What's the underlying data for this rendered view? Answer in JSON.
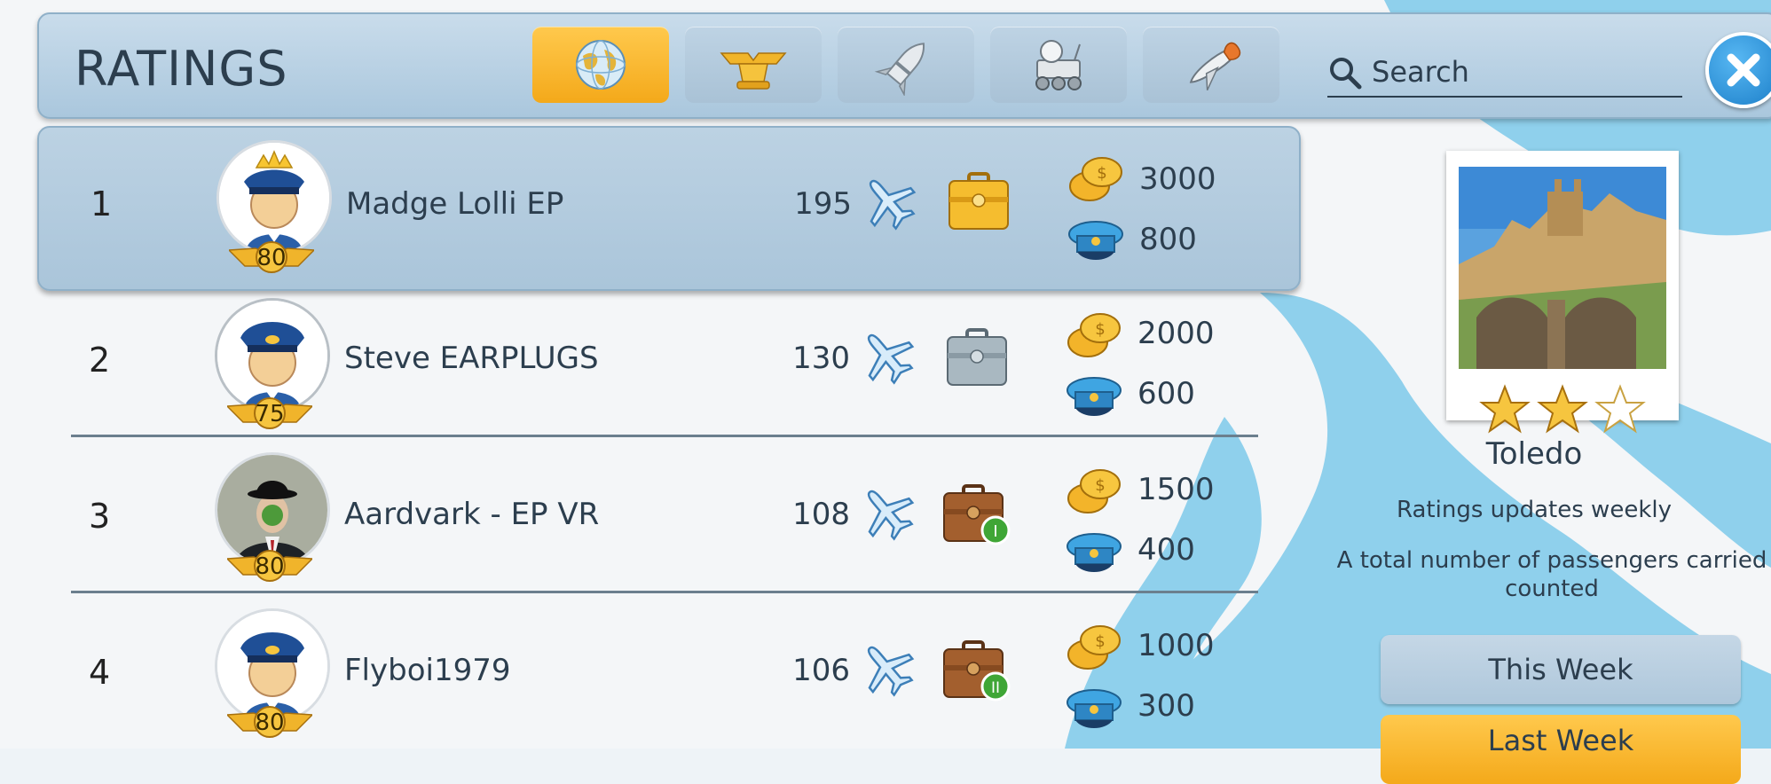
{
  "header": {
    "title": "RATINGS",
    "tabs": [
      {
        "icon": "globe-icon",
        "active": true
      },
      {
        "icon": "pilot-cap-wings-icon",
        "active": false
      },
      {
        "icon": "rocket-icon",
        "active": false
      },
      {
        "icon": "lunar-rover-icon",
        "active": false
      },
      {
        "icon": "space-shuttle-icon",
        "active": false
      }
    ],
    "search": {
      "placeholder": "Search",
      "icon": "search-icon"
    },
    "close_icon": "close-icon"
  },
  "rows": [
    {
      "rank": "1",
      "name": "Madge Lolli EP",
      "level": "80",
      "passengers": "195",
      "case": "gold-briefcase-icon",
      "coins": "3000",
      "caps": "800"
    },
    {
      "rank": "2",
      "name": "Steve EARPLUGS",
      "level": "75",
      "passengers": "130",
      "case": "silver-briefcase-icon",
      "coins": "2000",
      "caps": "600"
    },
    {
      "rank": "3",
      "name": "Aardvark - EP VR",
      "level": "80",
      "passengers": "108",
      "case": "brown-briefcase-rank-i-icon",
      "case_badge": "I",
      "coins": "1500",
      "caps": "400"
    },
    {
      "rank": "4",
      "name": "Flyboi1979",
      "level": "80",
      "passengers": "106",
      "case": "brown-briefcase-rank-ii-icon",
      "case_badge": "II",
      "coins": "1000",
      "caps": "300"
    }
  ],
  "side": {
    "city": "Toledo",
    "stars": 2,
    "max_stars": 3,
    "note1": "Ratings updates weekly",
    "note2": "A total number of passengers carried counted",
    "this_week": "This Week",
    "last_week": "Last Week"
  },
  "colors": {
    "accent": "#f4a91a",
    "header": "#aac7dd",
    "text": "#2c3e4e",
    "sea": "#8fd0ec"
  }
}
